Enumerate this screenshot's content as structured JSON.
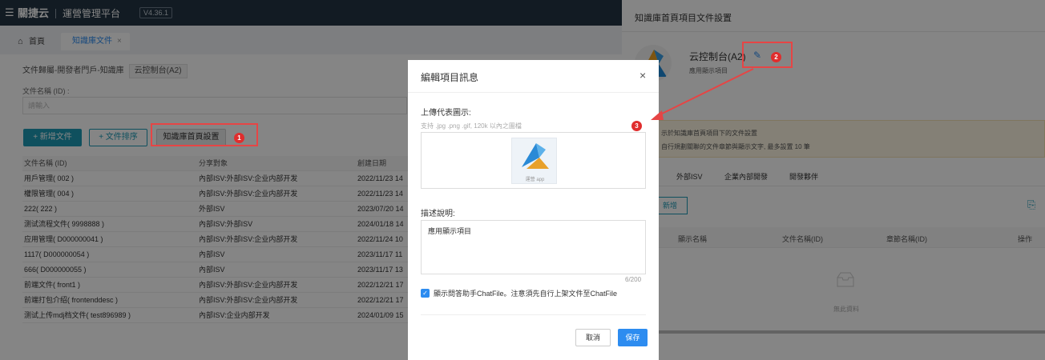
{
  "topbar": {
    "menu_icon": "hamburger-icon",
    "brand": "關捷云",
    "platform": "運營管理平台",
    "version": "V4.36.1"
  },
  "tabs": {
    "home": "首頁",
    "home_icon": "home-icon",
    "active": "知識庫文件",
    "close": "×"
  },
  "filter": {
    "group_label": "文件歸屬-開發者門戶-知識庫",
    "group_value": "云控制台(A2)",
    "name_label": "文件名稱 (ID) :",
    "name_placeholder": "請輸入"
  },
  "toolbar": {
    "add": "+ 新增文件",
    "sort": "+ 文件排序",
    "homepage_settings": "知識庫首頁設置"
  },
  "table": {
    "headers": [
      "文件名稱 (ID)",
      "分享對象",
      "創建日期"
    ],
    "rows": [
      [
        "用戶管理( 002 )",
        "內部ISV:外部ISV:企业内部开发",
        "2022/11/23 14"
      ],
      [
        "權限管理( 004 )",
        "內部ISV:外部ISV:企业内部开发",
        "2022/11/23 14"
      ],
      [
        "222( 222 )",
        "外部ISV",
        "2023/07/20 14"
      ],
      [
        "测试流程文件( 9998888 )",
        "內部ISV:外部ISV",
        "2024/01/18 14"
      ],
      [
        "应用管理( D000000041 )",
        "內部ISV:外部ISV:企业内部开发",
        "2022/11/24 10"
      ],
      [
        "1117( D000000054 )",
        "內部ISV",
        "2023/11/17 11"
      ],
      [
        "666( D000000055 )",
        "內部ISV",
        "2023/11/17 13"
      ],
      [
        "前端文件( front1 )",
        "內部ISV:外部ISV:企业内部开发",
        "2022/12/21 17"
      ],
      [
        "前端打包介绍( frontenddesc )",
        "內部ISV:外部ISV:企业内部开发",
        "2022/12/21 17"
      ],
      [
        "测试上传mdj档文件( test896989 )",
        "內部ISV:企业内部开发",
        "2024/01/09 15"
      ]
    ]
  },
  "drawer": {
    "title": "知識庫首頁項目文件設置",
    "app_name": "云控制台(A2)",
    "app_sub": "應用顯示項目",
    "edit_icon": "pencil-icon",
    "notice_line1": "示於知識庫首頁項目下的文件設置",
    "notice_line2": "自行規劃關聯的文件章節與顯示文字, 最多設置 10 筆",
    "tabs": [
      "外部ISV",
      "企業內部開發",
      "開發夥伴"
    ],
    "add": "新增",
    "export_icon": "export-icon",
    "columns": [
      "顯示名稱",
      "文件名稱(ID)",
      "章節名稱(ID)",
      "操作"
    ],
    "empty_icon": "empty-box-icon",
    "empty_text": "無此資料"
  },
  "modal": {
    "title": "編輯項目訊息",
    "close": "×",
    "upload_label": "上傳代表圖示:",
    "upload_hint": "支持 .jpg .png .gif, 120k 以內之圖檔",
    "thumb_label": "運營 app",
    "desc_label": "描述說明:",
    "desc_value": "應用顯示項目",
    "counter": "6/200",
    "checkbox_label": "顯示問答助手ChatFile。注意須先自行上架文件至ChatFile",
    "cancel": "取消",
    "save": "保存"
  },
  "annotations": {
    "badge1": "1",
    "badge2": "2",
    "badge3": "3",
    "color": "#e64545"
  },
  "colors": {
    "topbar": "#243443",
    "primary": "#1d9ab4",
    "accent_blue": "#2d8cf0",
    "overlay": "rgba(0,0,0,0.48)"
  }
}
